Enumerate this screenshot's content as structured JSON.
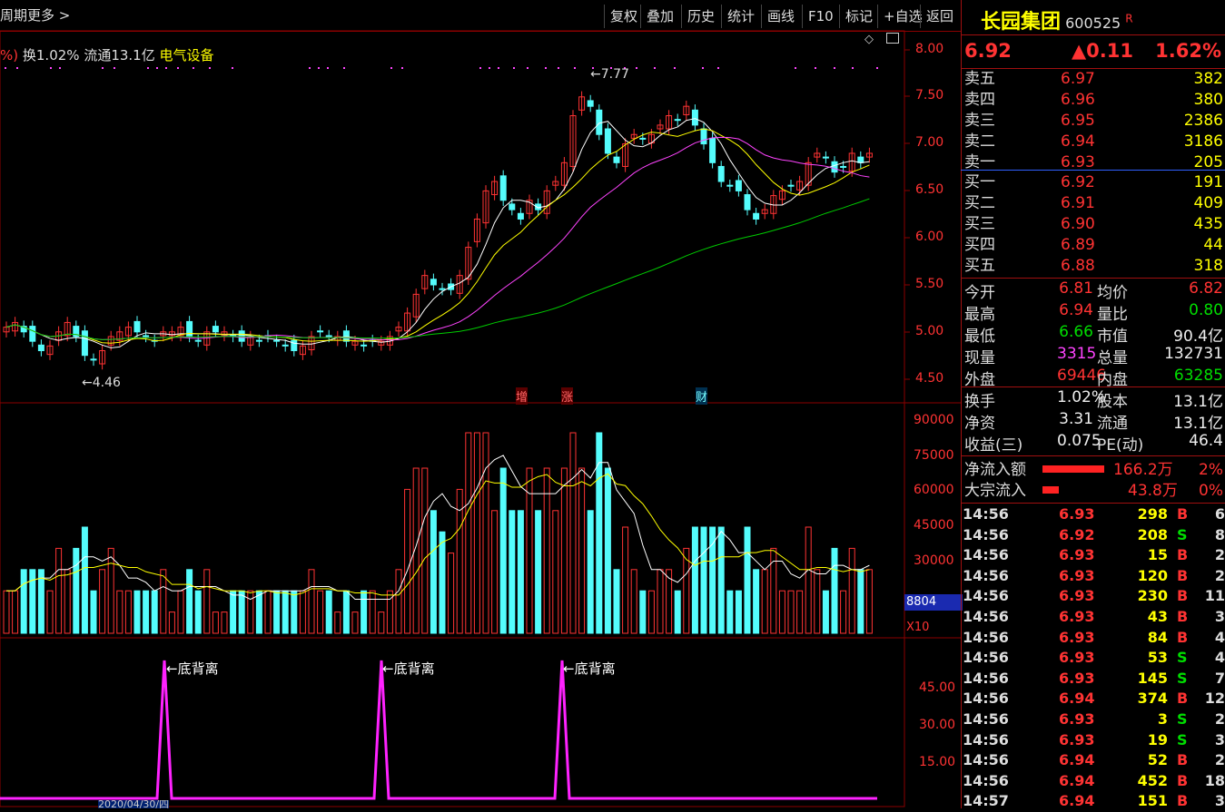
{
  "toolbar": {
    "left_partial": "周期",
    "more": "更多",
    "buttons": [
      "复权",
      "叠加",
      "历史",
      "统计",
      "画线",
      "F10",
      "标记",
      "+自选",
      "返回"
    ]
  },
  "info_line": {
    "prefix": "%)",
    "turnover": "换1.02%",
    "float": "流通13.1亿",
    "sector": "电气设备"
  },
  "price_axis": [
    "8.00",
    "7.50",
    "7.00",
    "6.50",
    "6.00",
    "5.50",
    "5.00",
    "4.50"
  ],
  "volume_axis": [
    "90000",
    "75000",
    "60000",
    "45000",
    "30000"
  ],
  "volume_readout": "8804",
  "volume_unit": "X10",
  "indicator_axis": [
    "45.00",
    "30.00",
    "15.00"
  ],
  "annotations": {
    "high": "7.77",
    "low": "4.46",
    "markers": [
      "增",
      "涨",
      "财"
    ],
    "divergence": [
      "底背离",
      "底背离",
      "底背离"
    ],
    "date_partial": "2020/04/30/四"
  },
  "stock": {
    "name": "长园集团",
    "code": "600525",
    "flag": "R",
    "price": "6.92",
    "change": "▲0.11",
    "pct": "1.62%"
  },
  "order_book": {
    "asks": [
      {
        "label": "卖五",
        "price": "6.97",
        "vol": "382"
      },
      {
        "label": "卖四",
        "price": "6.96",
        "vol": "380"
      },
      {
        "label": "卖三",
        "price": "6.95",
        "vol": "2386"
      },
      {
        "label": "卖二",
        "price": "6.94",
        "vol": "3186"
      },
      {
        "label": "卖一",
        "price": "6.93",
        "vol": "205"
      }
    ],
    "bids": [
      {
        "label": "买一",
        "price": "6.92",
        "vol": "191"
      },
      {
        "label": "买二",
        "price": "6.91",
        "vol": "409"
      },
      {
        "label": "买三",
        "price": "6.90",
        "vol": "435"
      },
      {
        "label": "买四",
        "price": "6.89",
        "vol": "44"
      },
      {
        "label": "买五",
        "price": "6.88",
        "vol": "318"
      }
    ]
  },
  "stats": {
    "open_label": "今开",
    "open": "6.81",
    "avg_label": "均价",
    "avg": "6.82",
    "high_label": "最高",
    "high": "6.94",
    "ratio_label": "量比",
    "ratio": "0.80",
    "low_label": "最低",
    "low": "6.66",
    "cap_label": "市值",
    "cap": "90.4亿",
    "cur_label": "现量",
    "cur": "3315",
    "total_label": "总量",
    "total": "132731",
    "out_label": "外盘",
    "out": "69446",
    "in_label": "内盘",
    "in": "63285",
    "turn_label": "换手",
    "turn": "1.02%",
    "shares_label": "股本",
    "shares": "13.1亿",
    "net_label": "净资",
    "net": "3.31",
    "float_label": "流通",
    "float": "13.1亿",
    "eps_label": "收益(三)",
    "eps": "0.075",
    "pe_label": "PE(动)",
    "pe": "46.4"
  },
  "flows": {
    "net_inflow_label": "净流入额",
    "net_inflow": "166.2万",
    "net_inflow_pct": "2%",
    "block_label": "大宗流入",
    "block": "43.8万",
    "block_pct": "0%"
  },
  "ticks": [
    {
      "t": "14:56",
      "p": "6.93",
      "v": "298",
      "d": "B",
      "n": "6"
    },
    {
      "t": "14:56",
      "p": "6.92",
      "v": "208",
      "d": "S",
      "n": "8"
    },
    {
      "t": "14:56",
      "p": "6.93",
      "v": "15",
      "d": "B",
      "n": "2"
    },
    {
      "t": "14:56",
      "p": "6.93",
      "v": "120",
      "d": "B",
      "n": "2"
    },
    {
      "t": "14:56",
      "p": "6.93",
      "v": "230",
      "d": "B",
      "n": "11"
    },
    {
      "t": "14:56",
      "p": "6.93",
      "v": "43",
      "d": "B",
      "n": "3"
    },
    {
      "t": "14:56",
      "p": "6.93",
      "v": "84",
      "d": "B",
      "n": "4"
    },
    {
      "t": "14:56",
      "p": "6.93",
      "v": "53",
      "d": "S",
      "n": "4"
    },
    {
      "t": "14:56",
      "p": "6.93",
      "v": "145",
      "d": "S",
      "n": "7"
    },
    {
      "t": "14:56",
      "p": "6.94",
      "v": "374",
      "d": "B",
      "n": "12"
    },
    {
      "t": "14:56",
      "p": "6.93",
      "v": "3",
      "d": "S",
      "n": "2"
    },
    {
      "t": "14:56",
      "p": "6.93",
      "v": "19",
      "d": "S",
      "n": "3"
    },
    {
      "t": "14:56",
      "p": "6.94",
      "v": "52",
      "d": "B",
      "n": "2"
    },
    {
      "t": "14:56",
      "p": "6.94",
      "v": "452",
      "d": "B",
      "n": "18"
    },
    {
      "t": "14:57",
      "p": "6.94",
      "v": "151",
      "d": "B",
      "n": "3"
    }
  ],
  "colors": {
    "up": "#ff3333",
    "down": "#54fcfc",
    "ma5": "#ffffff",
    "ma10": "#ffff00",
    "ma20": "#ff44ff",
    "ma60": "#00cc00",
    "grid": "#8b0000"
  }
}
